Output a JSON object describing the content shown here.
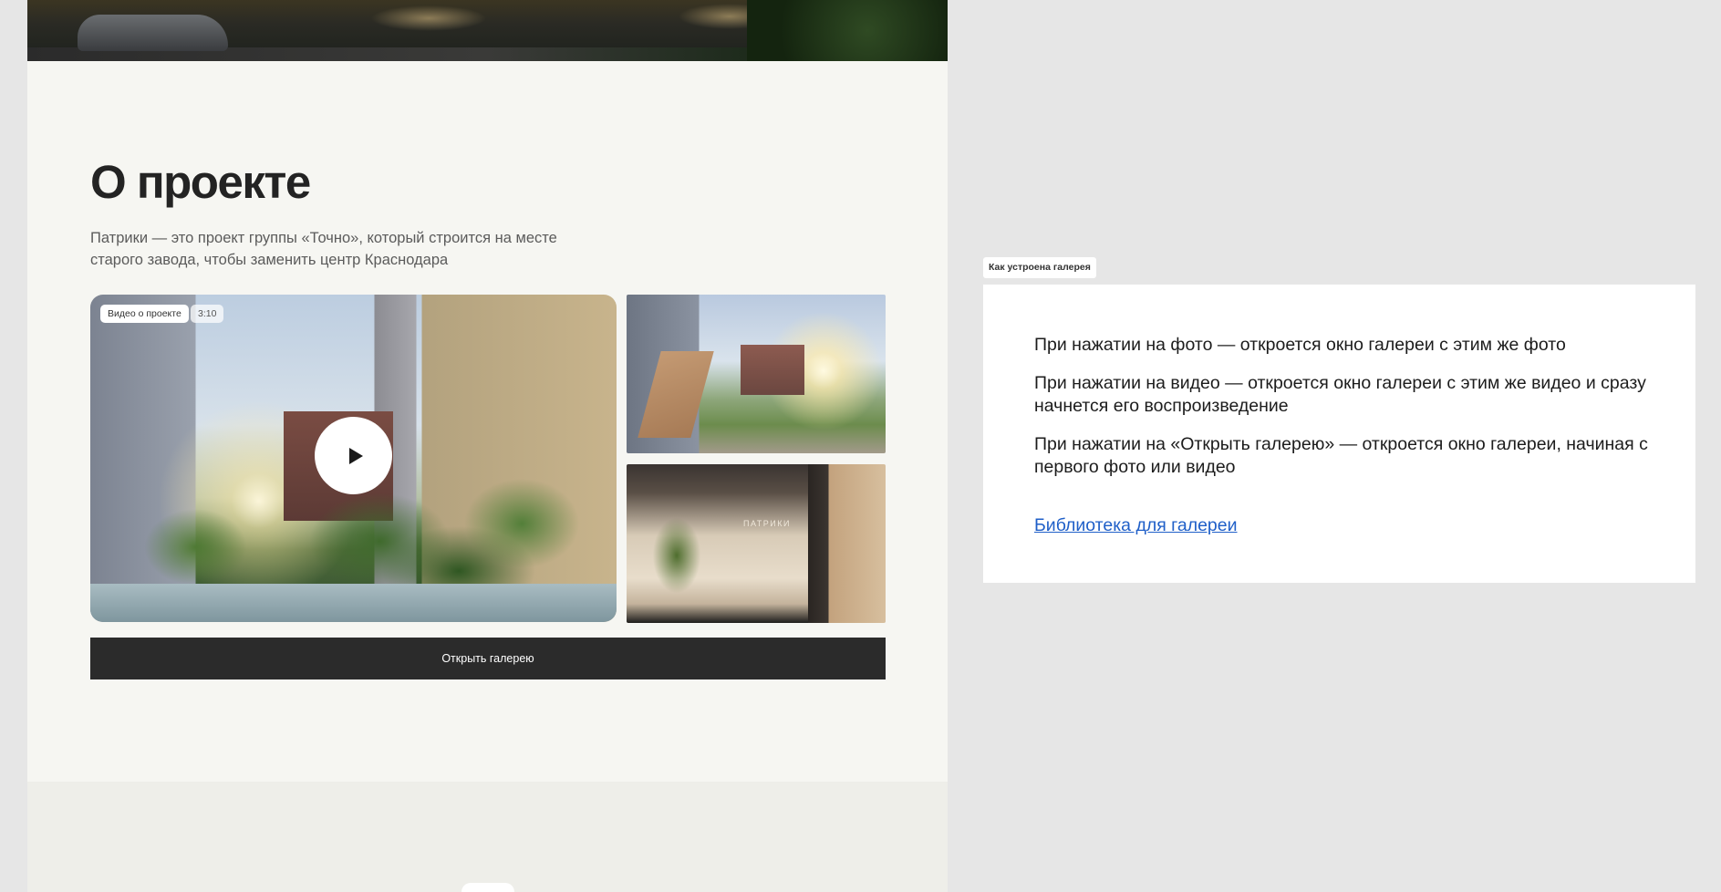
{
  "about": {
    "title": "О проекте",
    "description": "Патрики — это проект группы «Точно», который строится на месте старого завода, чтобы заменить центр Краснодара"
  },
  "video": {
    "badge_label": "Видео о проекте",
    "duration": "3:10",
    "play_icon": "play-icon"
  },
  "photos": [
    {
      "name": "playground-photo"
    },
    {
      "name": "lobby-photo",
      "sign_text": "ПАТРИКИ"
    }
  ],
  "gallery_button": {
    "label": "Открыть галерею"
  },
  "annotation": {
    "tag": "Как устроена галерея",
    "lines": [
      "При нажатии на фото — откроется окно галереи с этим же фото",
      "При нажатии на видео — откроется окно галереи с этим же видео и сразу начнется его воспроизведение",
      "При нажатии на «Открыть галерею» — откроется окно галереи, начиная с первого фото или видео"
    ],
    "link": "Библиотека для галереи"
  },
  "colors": {
    "page_bg": "#f6f6f2",
    "canvas_bg": "#e6e6e6",
    "button_bg": "#2b2b2b",
    "link": "#1f5fc8"
  }
}
